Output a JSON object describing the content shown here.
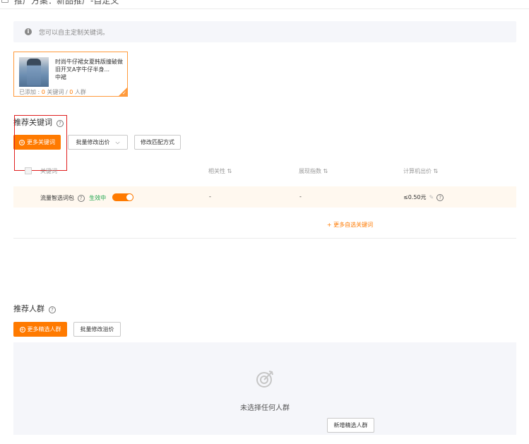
{
  "breadcrumb": "推广方案：新品推广-自定义",
  "notice": {
    "text": "您可以自主定制关键词。"
  },
  "product": {
    "title": "时尚牛仔裙女夏韩版撞破做旧开叉A字牛仔半身...",
    "subtitle": "中裙",
    "added_label": "已添加",
    "keyword_count": "0",
    "keyword_label": "关键词",
    "crowd_count": "0",
    "crowd_label": "人群"
  },
  "keywords": {
    "title": "推荐关键词",
    "buttons": {
      "more": "更多关键词",
      "batch_bid": "批量修改出价",
      "match_mode": "修改匹配方式"
    },
    "columns": {
      "keyword": "关键词",
      "relevance": "相关性",
      "impressions": "展现指数",
      "pc_bid": "计算机出价"
    },
    "rows": [
      {
        "name": "流量智选词包",
        "status": "生效中",
        "relevance": "-",
        "impressions": "-",
        "bid": "≤0.50元"
      }
    ],
    "more_link": "+ 更多自选关键词"
  },
  "crowd": {
    "title": "推荐人群",
    "buttons": {
      "more": "更多精选人群",
      "batch_bid": "批量修改溢价"
    },
    "empty_text": "未选择任何人群",
    "add_button": "新增精选人群"
  },
  "colors": {
    "accent": "#ff7a00",
    "active": "#1aa34a",
    "highlight": "#e02020"
  }
}
